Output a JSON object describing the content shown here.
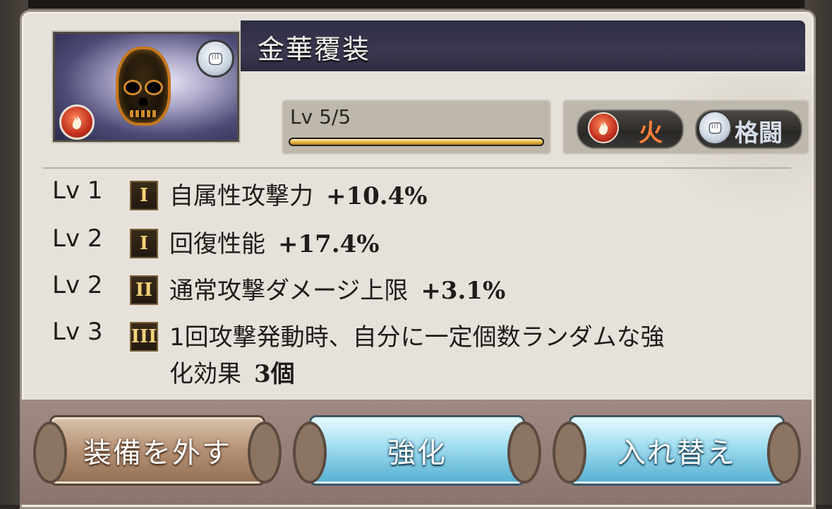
{
  "item": {
    "name": "金華覆装",
    "level_text": "Lv 5/5",
    "level_progress": 1.0,
    "element_icon": "fire-orb-icon",
    "weapon_icon": "fist-icon"
  },
  "tags": {
    "element": "火",
    "weapon_type": "格闘"
  },
  "skills": [
    {
      "level": "Lv 1",
      "tier": "I",
      "name": "自属性攻撃力",
      "value": "+10.4%"
    },
    {
      "level": "Lv 2",
      "tier": "I",
      "name": "回復性能",
      "value": "+17.4%"
    },
    {
      "level": "Lv 2",
      "tier": "II",
      "name": "通常攻撃ダメージ上限",
      "value": "+3.1%"
    },
    {
      "level": "Lv 3",
      "tier": "III",
      "name": "1回攻撃発動時、自分に一定個数ランダムな強",
      "name_line2": "化効果",
      "value": "3個"
    }
  ],
  "buttons": {
    "unequip": "装備を外す",
    "enhance": "強化",
    "swap": "入れ替え"
  },
  "colors": {
    "panel_bg": "#e6e2db",
    "title_bar": "#2e2d44",
    "fire_accent": "#ff7f3a",
    "button_blue": "#9fdcf0",
    "button_brown": "#b59175"
  }
}
